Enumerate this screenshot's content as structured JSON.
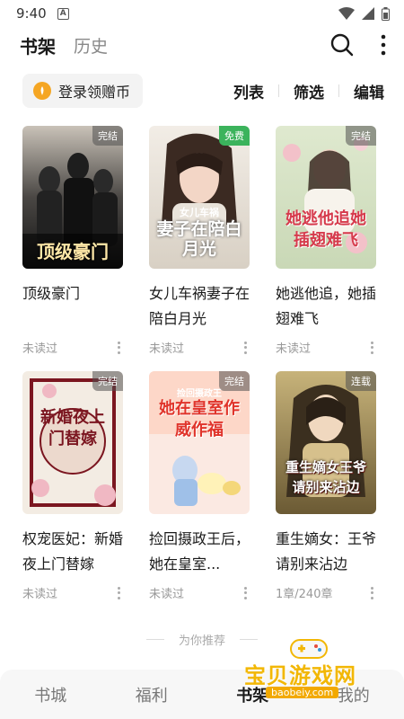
{
  "status_bar": {
    "time": "9:40",
    "notif_letter": "A"
  },
  "header": {
    "tab_active": "书架",
    "tab_history": "历史"
  },
  "toolbar": {
    "login_label": "登录领赠币",
    "list_label": "列表",
    "filter_label": "筛选",
    "edit_label": "编辑"
  },
  "books": [
    {
      "title": "顶级豪门",
      "cover_text": "顶级豪门",
      "badge": "完结",
      "badge_style": "gray",
      "progress": "未读过"
    },
    {
      "title": "女儿车祸妻子在陪白月光",
      "cover_text": "妻子在陪白月光",
      "cover_subtext": "女儿车祸",
      "badge": "免费",
      "badge_style": "green",
      "progress": "未读过"
    },
    {
      "title": "她逃他追，她插翅难飞",
      "cover_text": "她逃他追她插翅难飞",
      "badge": "完结",
      "badge_style": "gray",
      "progress": "未读过"
    },
    {
      "title": "权宠医妃：新婚夜上门替嫁",
      "cover_text": "新婚夜上门替嫁",
      "badge": "完结",
      "badge_style": "gray",
      "progress": "未读过"
    },
    {
      "title": "捡回摄政王后，她在皇室...",
      "cover_text": "她在皇室作威作福",
      "cover_subtext": "捡回摄政王",
      "badge": "完结",
      "badge_style": "gray",
      "progress": "未读过"
    },
    {
      "title": "重生嫡女：王爷请别来沾边",
      "cover_text": "重生嫡女王爷请别来沾边",
      "badge": "连载",
      "badge_style": "gray",
      "progress": "1章/240章"
    }
  ],
  "recommend_label": "为你推荐",
  "bottom_nav": {
    "items": [
      "书城",
      "福利",
      "书架",
      "我的"
    ],
    "active_index": 2
  },
  "watermark": {
    "text": "宝贝游戏网",
    "url": "baobeiy.com"
  },
  "colors": {
    "accent": "#f5a623",
    "free_badge": "#3bb35c",
    "watermark": "#f2b705"
  }
}
